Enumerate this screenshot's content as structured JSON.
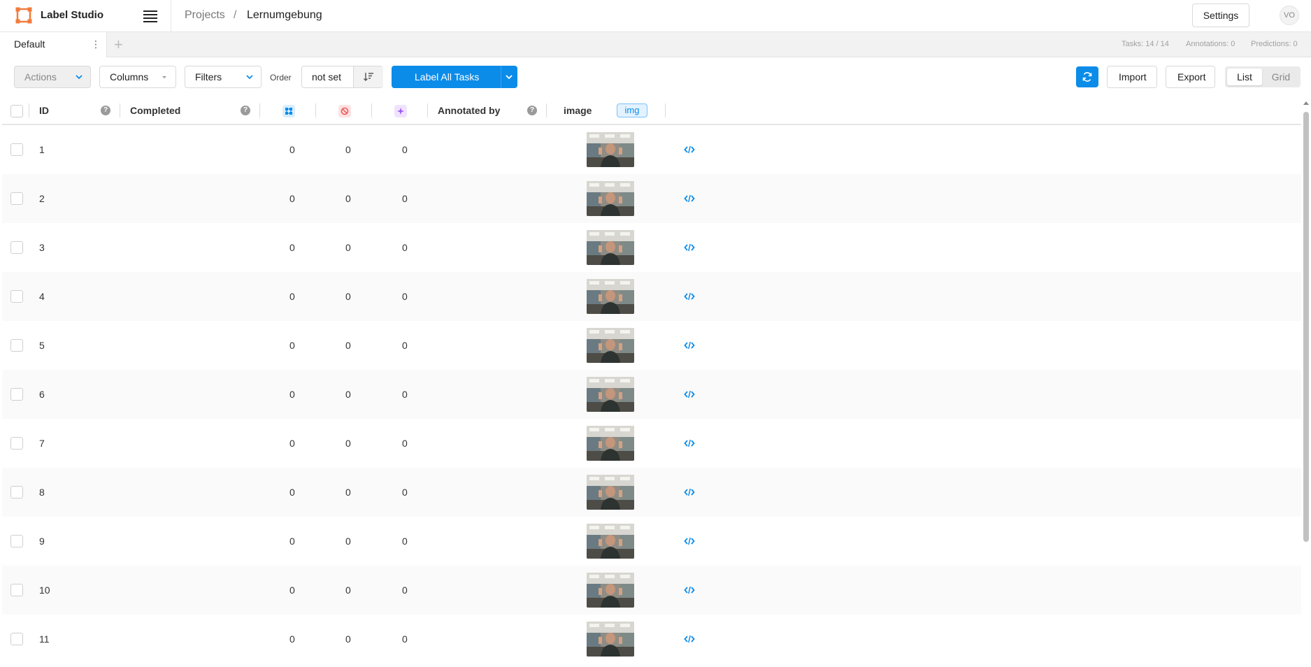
{
  "header": {
    "app_title": "Label Studio",
    "breadcrumb": {
      "projects": "Projects",
      "separator": "/",
      "current": "Lernumgebung"
    },
    "settings_label": "Settings",
    "avatar_initials": "VO"
  },
  "tabs": {
    "items": [
      {
        "label": "Default",
        "active": true
      }
    ],
    "menu_glyph": "⋮",
    "add_glyph": "+"
  },
  "stats": {
    "tasks": "Tasks: 14 / 14",
    "annotations": "Annotations: 0",
    "predictions": "Predictions: 0"
  },
  "toolbar": {
    "actions_label": "Actions",
    "columns_label": "Columns",
    "filters_label": "Filters",
    "order_label": "Order",
    "order_value": "not set",
    "label_all_label": "Label All Tasks",
    "import_label": "Import",
    "export_label": "Export",
    "view_list_label": "List",
    "view_grid_label": "Grid",
    "active_view": "List"
  },
  "table": {
    "columns": {
      "id": "ID",
      "completed": "Completed",
      "total_annotations_icon": "annotations-icon",
      "cancelled_icon": "cancelled-icon",
      "predictions_icon": "predictions-icon",
      "annotated_by": "Annotated by",
      "image": "image",
      "image_type": "img",
      "help_glyph": "?"
    },
    "rows": [
      {
        "id": "1",
        "total": "0",
        "cancelled": "0",
        "predictions": "0"
      },
      {
        "id": "2",
        "total": "0",
        "cancelled": "0",
        "predictions": "0"
      },
      {
        "id": "3",
        "total": "0",
        "cancelled": "0",
        "predictions": "0"
      },
      {
        "id": "4",
        "total": "0",
        "cancelled": "0",
        "predictions": "0"
      },
      {
        "id": "5",
        "total": "0",
        "cancelled": "0",
        "predictions": "0"
      },
      {
        "id": "6",
        "total": "0",
        "cancelled": "0",
        "predictions": "0"
      },
      {
        "id": "7",
        "total": "0",
        "cancelled": "0",
        "predictions": "0"
      },
      {
        "id": "8",
        "total": "0",
        "cancelled": "0",
        "predictions": "0"
      },
      {
        "id": "9",
        "total": "0",
        "cancelled": "0",
        "predictions": "0"
      },
      {
        "id": "10",
        "total": "0",
        "cancelled": "0",
        "predictions": "0"
      },
      {
        "id": "11",
        "total": "0",
        "cancelled": "0",
        "predictions": "0"
      }
    ]
  },
  "colors": {
    "accent": "#0c8ce9",
    "logo": "#f07c3c",
    "cancel_icon": "#f05a5a",
    "predictions_icon": "#9b59f5"
  }
}
